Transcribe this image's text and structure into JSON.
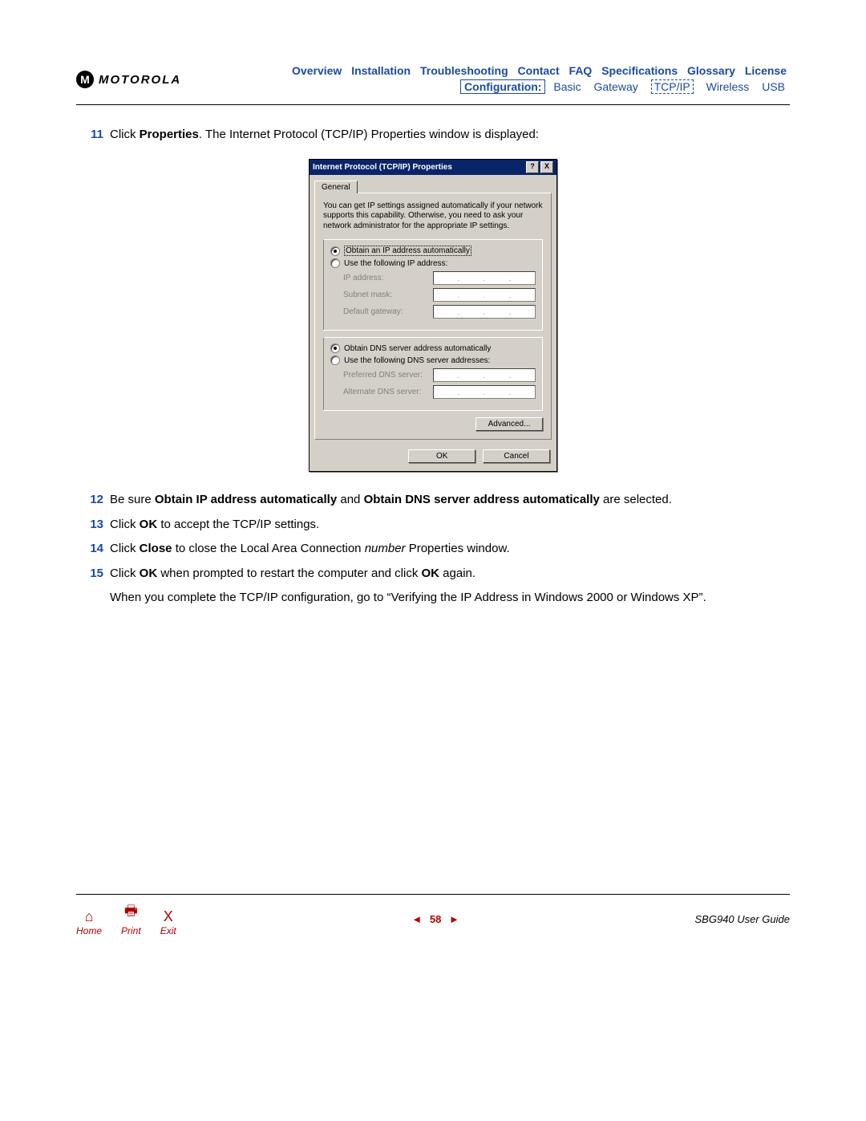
{
  "brand": "MOTOROLA",
  "nav": {
    "items": [
      "Overview",
      "Installation",
      "Troubleshooting",
      "Contact",
      "FAQ",
      "Specifications",
      "Glossary",
      "License"
    ],
    "sub_label": "Configuration:",
    "sub_items": [
      "Basic",
      "Gateway",
      "TCP/IP",
      "Wireless",
      "USB"
    ]
  },
  "steps": {
    "s11_num": "11",
    "s11_a": "Click ",
    "s11_b": "Properties",
    "s11_c": ". The Internet Protocol (TCP/IP) Properties window is displayed:",
    "s12_num": "12",
    "s12_a": "Be sure ",
    "s12_b": "Obtain IP address automatically",
    "s12_c": " and ",
    "s12_d": "Obtain DNS server address automatically",
    "s12_e": " are selected.",
    "s13_num": "13",
    "s13_a": "Click ",
    "s13_b": "OK",
    "s13_c": " to accept the TCP/IP settings.",
    "s14_num": "14",
    "s14_a": "Click ",
    "s14_b": "Close",
    "s14_c": " to close the Local Area Connection ",
    "s14_d": "number",
    "s14_e": " Properties window.",
    "s15_num": "15",
    "s15_a": "Click ",
    "s15_b": "OK",
    "s15_c": " when prompted to restart the computer and click ",
    "s15_d": "OK",
    "s15_e": " again.",
    "closing_a": "When you complete the TCP/IP configuration, go to ",
    "closing_link": "“Verifying the IP Address in Windows 2000 or Windows XP”",
    "closing_b": "."
  },
  "dialog": {
    "title": "Internet Protocol (TCP/IP) Properties",
    "help_btn": "?",
    "close_btn": "X",
    "tab": "General",
    "desc": "You can get IP settings assigned automatically if your network supports this capability. Otherwise, you need to ask your network administrator for the appropriate IP settings.",
    "r_obtain_ip": "Obtain an IP address automatically",
    "r_use_ip": "Use the following IP address:",
    "f_ip": "IP address:",
    "f_subnet": "Subnet mask:",
    "f_gateway": "Default gateway:",
    "r_obtain_dns": "Obtain DNS server address automatically",
    "r_use_dns": "Use the following DNS server addresses:",
    "f_pref_dns": "Preferred DNS server:",
    "f_alt_dns": "Alternate DNS server:",
    "btn_advanced": "Advanced...",
    "btn_ok": "OK",
    "btn_cancel": "Cancel"
  },
  "footer": {
    "home": "Home",
    "print": "Print",
    "exit": "Exit",
    "page": "58",
    "guide": "SBG940 User Guide"
  }
}
